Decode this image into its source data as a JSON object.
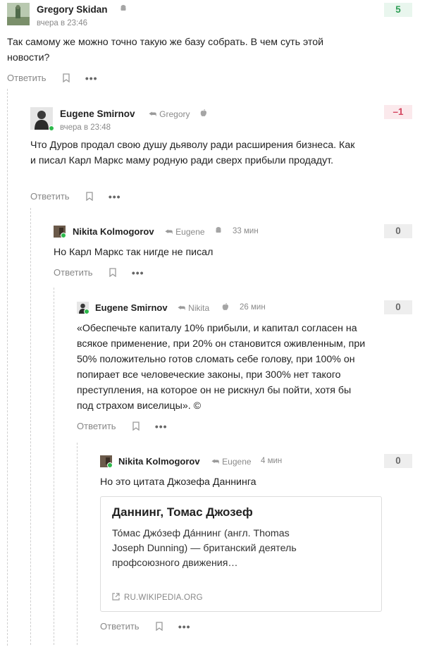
{
  "comments": [
    {
      "author": "Gregory Skidan",
      "time": "вчера в 23:46",
      "score": "5",
      "body": "Так самому же можно точно такую же базу собрать. В чем суть этой новости?",
      "reply_label": "Ответить",
      "device_icon": "android-icon"
    },
    {
      "author": "Eugene Smirnov",
      "reply_to": "Gregory",
      "time": "вчера в 23:48",
      "score": "–1",
      "body": "Что Дуров продал свою душу дьяволу ради расширения бизнеса. Как и писал Карл Маркс маму родную ради сверх прибыли продадут.",
      "reply_label": "Ответить",
      "device_icon": "apple-icon"
    },
    {
      "author": "Nikita Kolmogorov",
      "reply_to": "Eugene",
      "time": "33 мин",
      "score": "0",
      "body": "Но Карл Маркс так нигде не писал",
      "reply_label": "Ответить",
      "device_icon": "android-icon"
    },
    {
      "author": "Eugene Smirnov",
      "reply_to": "Nikita",
      "time": "26 мин",
      "score": "0",
      "body": "«Обеспечьте капиталу 10% прибыли, и капитал согласен на всякое применение, при 20% он становится оживленным, при 50% положительно готов сломать себе голову, при 100% он попирает все человеческие законы, при 300% нет такого преступления, на которое он не рискнул бы пойти, хотя бы под страхом виселицы». ©",
      "reply_label": "Ответить",
      "device_icon": "apple-icon"
    },
    {
      "author": "Nikita Kolmogorov",
      "reply_to": "Eugene",
      "time": "4 мин",
      "score": "0",
      "body": "Но это цитата Джозефа Даннинга",
      "reply_label": "Ответить",
      "link_card": {
        "title": "Даннинг, Томас Джозеф",
        "description": "То́мас Джо́зеф Да́ннинг (англ. Thomas Joseph Dunning) — британский деятель профсоюзного движения…",
        "source": "RU.WIKIPEDIA.ORG"
      }
    }
  ],
  "colors": {
    "score_positive": "#2e9e55",
    "score_negative": "#d4455f",
    "online": "#2db84b"
  }
}
